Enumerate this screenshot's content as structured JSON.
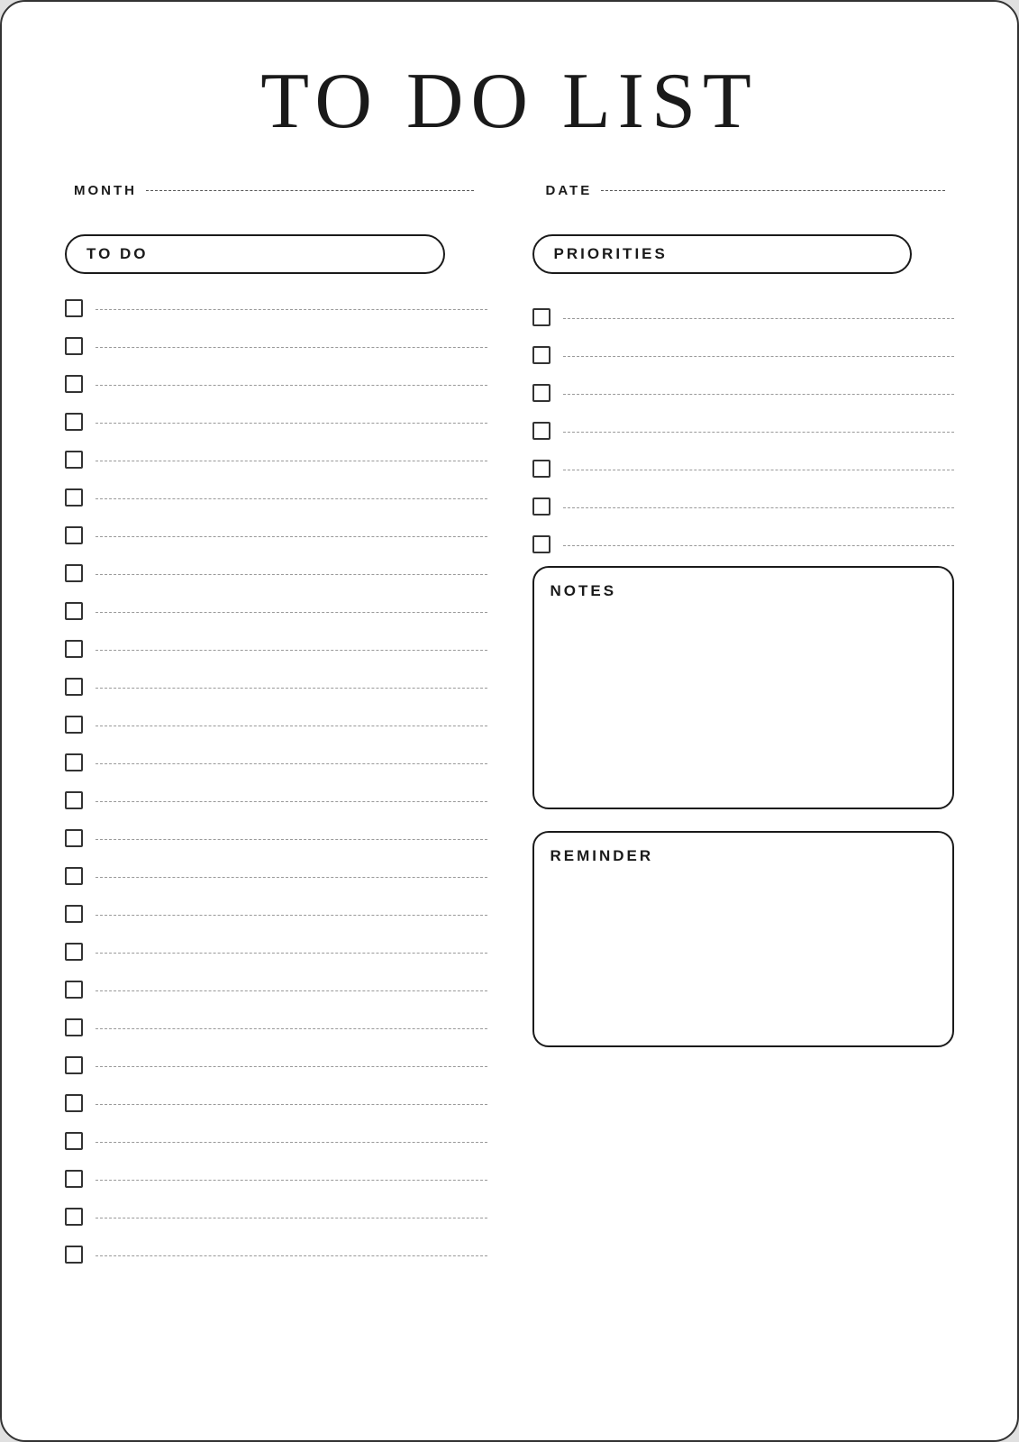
{
  "page": {
    "title": "TO DO LIST",
    "meta": {
      "month_label": "MONTH",
      "date_label": "DATE"
    },
    "todo_section": {
      "header": "TO DO",
      "items_count": 26
    },
    "priorities_section": {
      "header": "PRIORITIES",
      "items_count": 7
    },
    "notes_section": {
      "header": "NOTES"
    },
    "reminder_section": {
      "header": "REMINDER"
    }
  }
}
